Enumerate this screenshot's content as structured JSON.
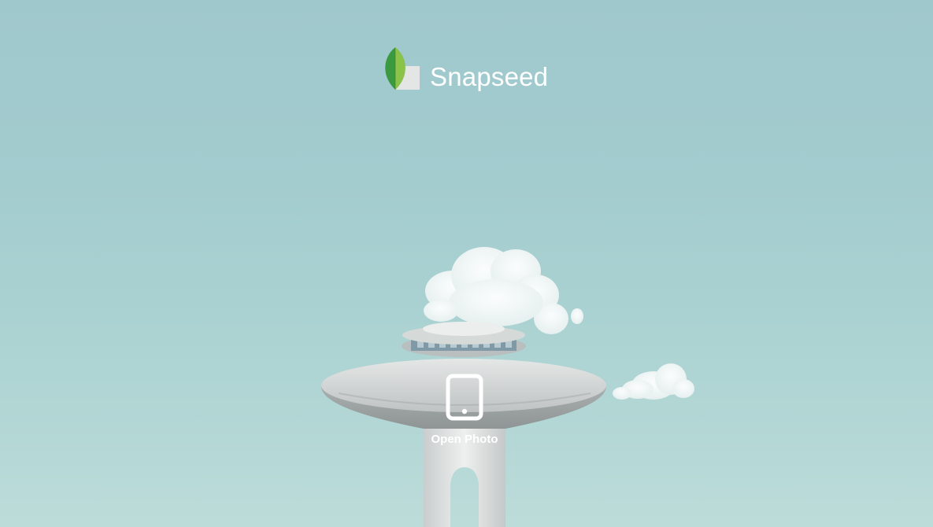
{
  "app": {
    "name": "Snapseed"
  },
  "main": {
    "open_photo_label": "Open Photo",
    "open_photo_icon": "tablet-icon"
  },
  "colors": {
    "sky": "#a3cccf",
    "text": "#ffffff",
    "leaf_dark": "#2e8b3a",
    "leaf_light": "#8bc34a"
  }
}
